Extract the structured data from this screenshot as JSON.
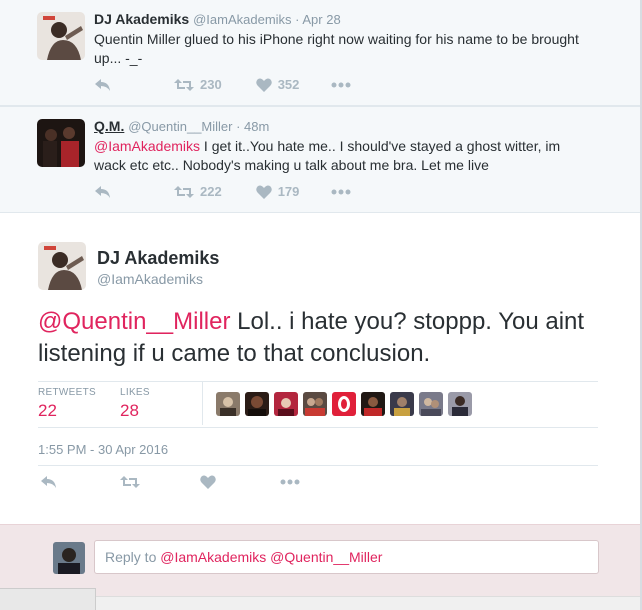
{
  "ctx_tweets": [
    {
      "name": "DJ Akademiks",
      "handle": "@IamAkademiks",
      "sep": " · ",
      "time": "Apr 28",
      "text_line1": "Quentin Miller glued to his iPhone right now waiting for his name to be brought",
      "text_line2": "up... -_-",
      "retweets": "230",
      "likes": "352"
    },
    {
      "name": "Q.M.",
      "handle": "@Quentin__Miller",
      "sep": " · ",
      "time": "48m",
      "mention": "@IamAkademiks",
      "text_line1_rest": " I get it..You hate me.. I should've stayed a ghost witter, im",
      "text_line2": "wack etc etc.. Nobody's making u talk about me bra. Let me live",
      "retweets": "222",
      "likes": "179"
    }
  ],
  "main_tweet": {
    "name": "DJ Akademiks",
    "handle": "@IamAkademiks",
    "mention": "@Quentin__Miller",
    "text_rest": " Lol.. i hate you? stoppp. You aint listening if u came to that conclusion.",
    "retweets_label": "RETWEETS",
    "retweets": "22",
    "likes_label": "LIKES",
    "likes": "28",
    "timestamp": "1:55 PM - 30 Apr 2016"
  },
  "reply": {
    "prefix": "Reply to ",
    "mention1": "@IamAkademiks",
    "mention2": "@Quentin__Miller"
  },
  "colors": {
    "accent": "#e0245e",
    "muted": "#8899a6",
    "icon": "#aab8c2"
  }
}
